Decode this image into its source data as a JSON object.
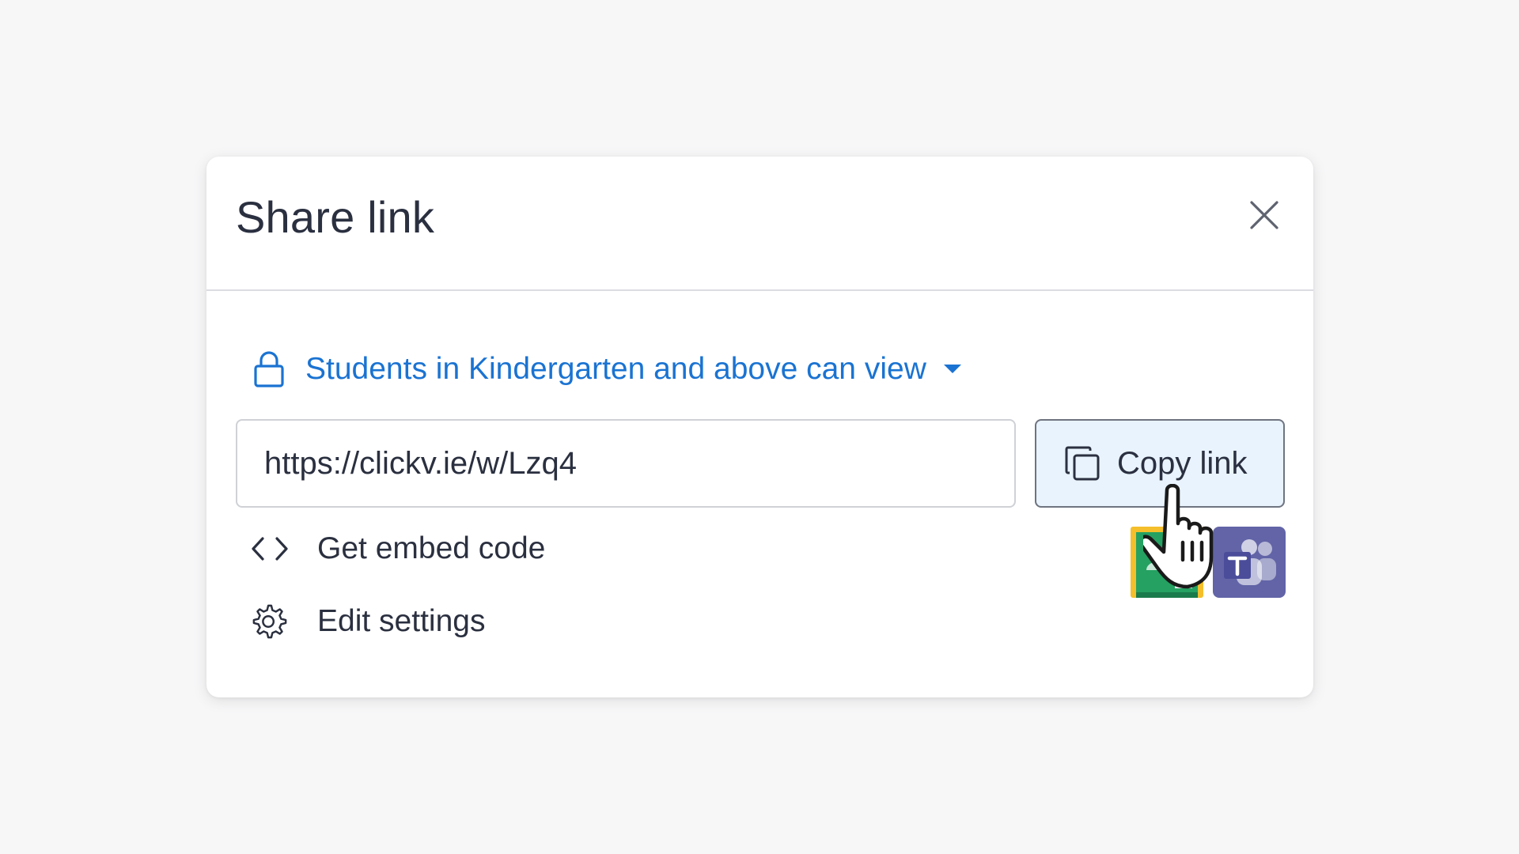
{
  "dialog": {
    "title": "Share link",
    "close_icon": "close-icon"
  },
  "access": {
    "icon": "lock-icon",
    "label": "Students in Kindergarten and above can view",
    "dropdown_icon": "caret-down-icon",
    "color": "#1a73d2"
  },
  "link": {
    "url": "https://clickv.ie/w/Lzq4",
    "copy_icon": "copy-icon",
    "copy_label": "Copy link",
    "copy_button_bg": "#e8f3fd"
  },
  "menu": {
    "embed_icon": "code-icon",
    "embed_label": "Get embed code",
    "settings_icon": "gear-icon",
    "settings_label": "Edit settings"
  },
  "share_targets": [
    {
      "name": "Google Classroom",
      "icon": "google-classroom-icon",
      "color": "#f4bf2a"
    },
    {
      "name": "Microsoft Teams",
      "icon": "microsoft-teams-icon",
      "color": "#6264a7"
    }
  ]
}
